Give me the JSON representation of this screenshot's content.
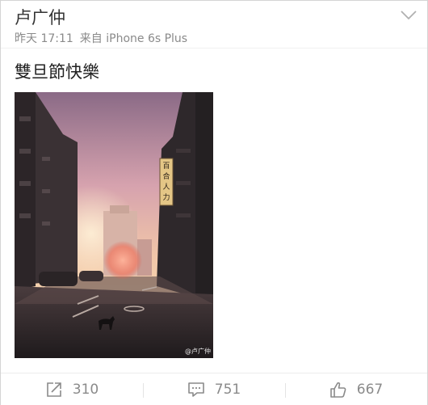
{
  "post": {
    "author": "卢广仲",
    "time": "昨天 17:11",
    "source": "来自 iPhone 6s Plus",
    "text": "雙旦節快樂",
    "image": {
      "watermark": "@卢广仲",
      "sign_text": "百合人力"
    }
  },
  "actions": {
    "repost_count": "310",
    "comment_count": "751",
    "like_count": "667"
  },
  "icons": {
    "menu": "chevron-down-icon",
    "repost": "share-icon",
    "comment": "comment-icon",
    "like": "thumbs-up-icon"
  },
  "colors": {
    "text": "#333333",
    "meta": "#8a8a8a",
    "icon": "#8a8a8a"
  }
}
